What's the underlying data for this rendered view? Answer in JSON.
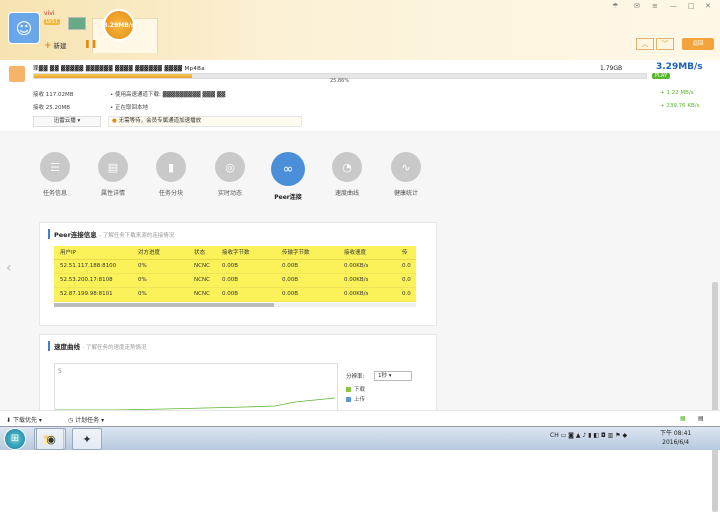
{
  "header": {
    "username": "vivi",
    "level": "LV11",
    "speed_tab": "3.29MB/s",
    "new_label": "新建",
    "back_label": "返回",
    "prev_icon": "chevron-up-icon",
    "next_icon": "chevron-down-icon"
  },
  "task": {
    "filename": "罪▓▓ ▓▓ ▓▓▓▓▓ ▓▓▓▓▓▓ ▓▓▓▓ ▓▓▓▓▓▓ ▓▓▓▓ Mp4Ba",
    "size": "1.79GB",
    "speed": "3.29MB/s",
    "play_label": "PLAY",
    "progress_percent": 25.86,
    "progress_text": "25.86%",
    "received_label": "接收 117.02MB",
    "high_speed_text": "• 使用高速通道下载: ▓▓▓▓▓▓▓▓▓ ▓▓▓ ▓▓",
    "up_speed": "+ 1.22  MB/s",
    "received2_label": "接收 25.20MB",
    "saving_text": "• 正在取回本地",
    "down_speed": "+ 239.76 KB/s",
    "cloud_btn": "迅雷云播",
    "notice": "无需等待，会员专属通道加速播放"
  },
  "tabs": [
    {
      "label": "任务信息",
      "icon": "list-icon"
    },
    {
      "label": "属性详情",
      "icon": "detail-icon"
    },
    {
      "label": "任务分块",
      "icon": "bar-chart-icon"
    },
    {
      "label": "实时动态",
      "icon": "compass-icon"
    },
    {
      "label": "Peer连接",
      "icon": "link-icon"
    },
    {
      "label": "速度曲线",
      "icon": "gauge-icon"
    },
    {
      "label": "健康统计",
      "icon": "pulse-icon"
    }
  ],
  "peer_panel": {
    "title": "Peer连接信息",
    "subtitle": "- 了解任务下载来源的连接情况",
    "columns": [
      "用户IP",
      "对方进度",
      "状态",
      "接收字节数",
      "传输字节数",
      "接收速度",
      "传"
    ],
    "rows": [
      [
        "52.51.117.188:8100",
        "0%",
        "NCNC",
        "0.00B",
        "0.00B",
        "0.00KB/s",
        "0.0"
      ],
      [
        "52.53.200.17:8108",
        "0%",
        "NCNC",
        "0.00B",
        "0.00B",
        "0.00KB/s",
        "0.0"
      ],
      [
        "52.87.199.98:8101",
        "0%",
        "NCNC",
        "0.00B",
        "0.00B",
        "0.00KB/s",
        "0.0"
      ]
    ]
  },
  "speed_panel": {
    "title": "速度曲线",
    "subtitle": "- 了解任务的速度走势情况",
    "y_label": "5",
    "rate_label": "分辨率:",
    "rate_value": "1秒",
    "legend_down": "下载",
    "legend_up": "上传"
  },
  "statusbar": {
    "download_first": "下载优先",
    "schedule": "计划任务"
  },
  "taskbar": {
    "ime": "CH",
    "time": "下午 08:41",
    "date": "2016/6/4"
  },
  "colors": {
    "accent": "#e48a12",
    "blue": "#4b8fd8",
    "highlight": "#fbf25a",
    "download_line": "#5ab52e"
  }
}
